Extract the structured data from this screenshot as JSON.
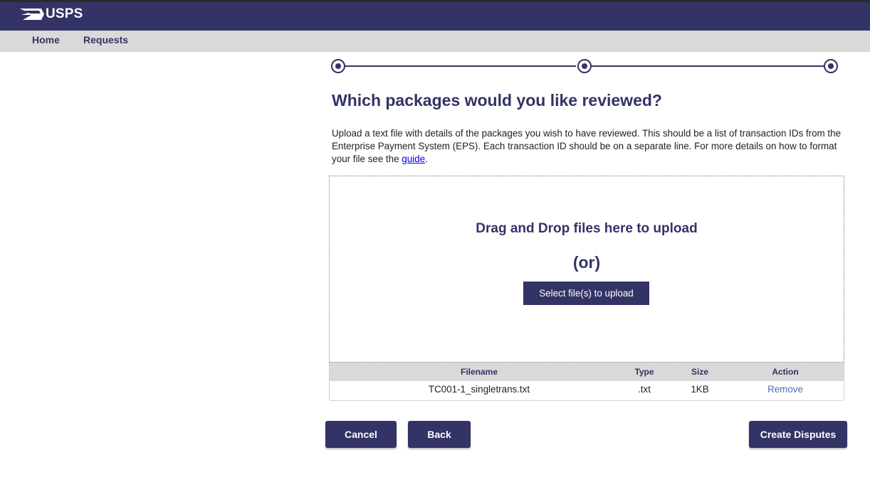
{
  "brand": {
    "name": "USPS",
    "primary_color": "#333366",
    "nav_bg": "#d9d9d9"
  },
  "nav": {
    "items": [
      {
        "label": "Home"
      },
      {
        "label": "Requests"
      }
    ]
  },
  "stepper": {
    "steps_total": 3,
    "icons": [
      "radio-filled-icon",
      "radio-filled-icon",
      "radio-filled-icon"
    ]
  },
  "page": {
    "heading": "Which packages would you like reviewed?",
    "intro_text": "Upload a text file with details of the packages you wish to have reviewed. This should be a list of transaction IDs from the Enterprise Payment System (EPS). Each transaction ID should be on a separate line. For more details on how to format your file see the ",
    "intro_link": "guide",
    "intro_end": "."
  },
  "dropzone": {
    "title": "Drag and Drop files here to upload",
    "or_text": "(or)",
    "select_button": "Select file(s) to upload"
  },
  "file_table": {
    "headers": {
      "filename": "Filename",
      "type": "Type",
      "size": "Size",
      "action": "Action"
    },
    "rows": [
      {
        "filename": "TC001-1_singletrans.txt",
        "type": ".txt",
        "size": "1KB",
        "action": "Remove"
      }
    ]
  },
  "actions": {
    "cancel": "Cancel",
    "back": "Back",
    "create": "Create Disputes"
  }
}
